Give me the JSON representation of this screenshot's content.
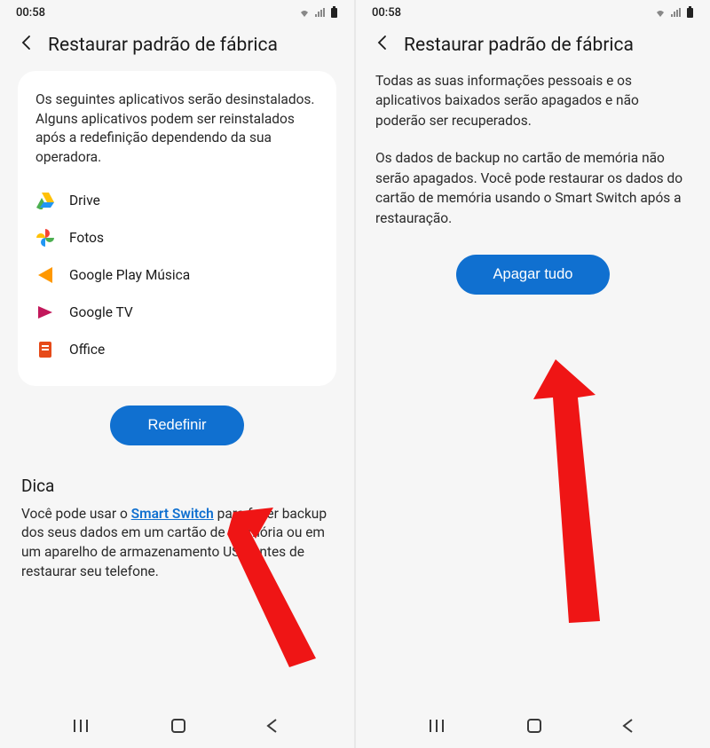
{
  "left": {
    "status": {
      "time": "00:58"
    },
    "header": {
      "title": "Restaurar padrão de fábrica"
    },
    "card": {
      "intro": "Os seguintes aplicativos serão desinstalados. Alguns aplicativos podem ser reinstalados após a redefinição dependendo da sua operadora.",
      "apps": [
        {
          "icon": "drive",
          "name": "Drive"
        },
        {
          "icon": "photos",
          "name": "Fotos"
        },
        {
          "icon": "play-music",
          "name": "Google Play Música"
        },
        {
          "icon": "google-tv",
          "name": "Google TV"
        },
        {
          "icon": "office",
          "name": "Office"
        }
      ]
    },
    "button_label": "Redefinir",
    "tip": {
      "title": "Dica",
      "text_before": "Você pode usar o ",
      "link": "Smart Switch",
      "text_after": " para fazer backup dos seus dados em um cartão de memória ou em um aparelho de armazenamento USB antes de restaurar seu telefone."
    }
  },
  "right": {
    "status": {
      "time": "00:58"
    },
    "header": {
      "title": "Restaurar padrão de fábrica"
    },
    "p1": "Todas as suas informações pessoais e os aplicativos baixados serão apagados e não poderão ser recuperados.",
    "p2": "Os dados de backup no cartão de memória não serão apagados. Você pode restaurar os dados do cartão de memória usando o Smart Switch após a restauração.",
    "button_label": "Apagar tudo"
  }
}
